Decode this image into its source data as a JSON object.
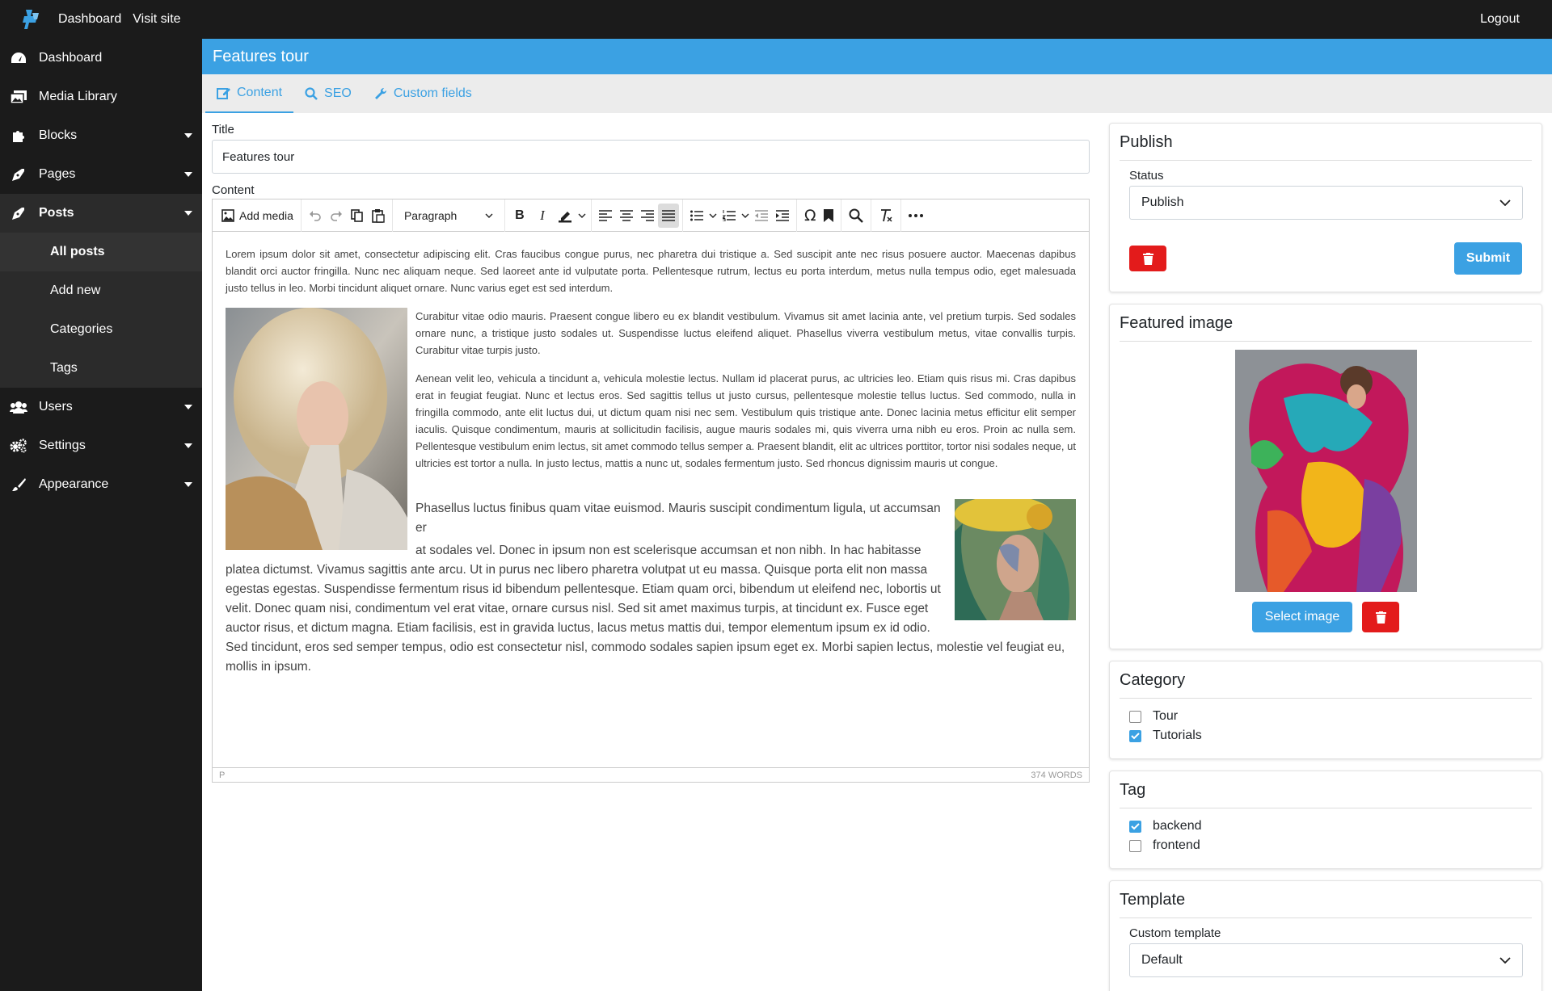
{
  "topbar": {
    "dashboard": "Dashboard",
    "visit_site": "Visit site",
    "logout": "Logout"
  },
  "sidebar": {
    "items": [
      {
        "label": "Dashboard",
        "icon": "tachometer-icon"
      },
      {
        "label": "Media Library",
        "icon": "images-icon"
      },
      {
        "label": "Blocks",
        "icon": "puzzle-icon"
      },
      {
        "label": "Pages",
        "icon": "pen-nib-icon"
      },
      {
        "label": "Posts",
        "icon": "pen-nib-icon"
      },
      {
        "label": "Users",
        "icon": "users-icon"
      },
      {
        "label": "Settings",
        "icon": "cogs-icon"
      },
      {
        "label": "Appearance",
        "icon": "paint-brush-icon"
      }
    ],
    "posts_sub": [
      "All posts",
      "Add new",
      "Categories",
      "Tags"
    ]
  },
  "page_title": "Features tour",
  "tabs": [
    "Content",
    "SEO",
    "Custom fields"
  ],
  "form": {
    "title_label": "Title",
    "title_value": "Features tour",
    "content_label": "Content"
  },
  "editor": {
    "add_media": "Add media",
    "format": "Paragraph",
    "p1": "Lorem ipsum dolor sit amet, consectetur adipiscing elit. Cras faucibus congue purus, nec pharetra dui tristique a. Sed suscipit ante nec risus posuere auctor. Maecenas dapibus blandit orci auctor fringilla. Nunc nec aliquam neque. Sed laoreet ante id vulputate porta. Pellentesque rutrum, lectus eu porta interdum, metus nulla tempus odio, eget malesuada justo tellus in leo. Morbi tincidunt aliquet ornare. Nunc varius eget est sed interdum.",
    "p2": "Curabitur vitae odio mauris. Praesent congue libero eu ex blandit vestibulum. Vivamus sit amet lacinia ante, vel pretium turpis. Sed sodales ornare nunc, a tristique justo sodales ut. Suspendisse luctus eleifend aliquet. Phasellus viverra vestibulum metus, vitae convallis turpis. Curabitur vitae turpis justo.",
    "p3": "Aenean velit leo, vehicula a tincidunt a, vehicula molestie lectus. Nullam id placerat purus, ac ultricies leo. Etiam quis risus mi. Cras dapibus erat in feugiat feugiat. Nunc et lectus eros. Sed sagittis tellus ut justo cursus, pellentesque molestie tellus luctus. Sed commodo, nulla in fringilla commodo, ante elit luctus dui, ut dictum quam nisi nec sem. Vestibulum quis tristique ante. Donec lacinia metus efficitur elit semper iaculis. Quisque condimentum, mauris at sollicitudin facilisis, augue mauris sodales mi, quis viverra urna nibh eu eros. Proin ac nulla sem. Pellentesque vestibulum enim lectus, sit amet commodo tellus semper a. Praesent blandit, elit ac ultrices porttitor, tortor nisi sodales neque, ut ultricies est tortor a nulla. In justo lectus, mattis a nunc ut, sodales fermentum justo. Sed rhoncus dignissim mauris ut congue.",
    "p4a": "Phasellus luctus finibus quam vitae euismod. Mauris suscipit condimentum ligula, ut accumsan er",
    "p4b": "at sodales vel. Donec in ipsum non est scelerisque accumsan et non nibh. In hac habitasse platea dictumst. Vivamus sagittis ante arcu. Ut in purus nec libero pharetra volutpat ut eu massa. Quisque porta elit non massa egestas egestas. Suspendisse fermentum risus id bibendum pellentesque. Etiam quam orci, bibendum ut eleifend nec, lobortis ut velit. Donec quam nisi, condimentum vel erat vitae, ornare cursus nisl. Sed sit amet maximus turpis, at tincidunt ex. Fusce eget auctor risus, et dictum magna. Etiam facilisis, est in gravida luctus, lacus metus mattis dui, tempor elementum ipsum ex id odio. Sed tincidunt, eros sed semper tempus, odio est consectetur nisl, commodo sodales sapien ipsum eget ex. Morbi sapien lectus, molestie vel feugiat eu, mollis in ipsum.",
    "status_path": "P",
    "word_count": "374 WORDS"
  },
  "publish": {
    "title": "Publish",
    "status_label": "Status",
    "status_value": "Publish",
    "submit": "Submit"
  },
  "featured": {
    "title": "Featured image",
    "select": "Select image"
  },
  "category": {
    "title": "Category",
    "items": [
      {
        "label": "Tour",
        "checked": false
      },
      {
        "label": "Tutorials",
        "checked": true
      }
    ]
  },
  "tag": {
    "title": "Tag",
    "items": [
      {
        "label": "backend",
        "checked": true
      },
      {
        "label": "frontend",
        "checked": false
      }
    ]
  },
  "template": {
    "title": "Template",
    "label": "Custom template",
    "value": "Default"
  },
  "colors": {
    "accent": "#3ba1e3",
    "danger": "#e31b1b",
    "sidebar": "#1b1b1b"
  }
}
